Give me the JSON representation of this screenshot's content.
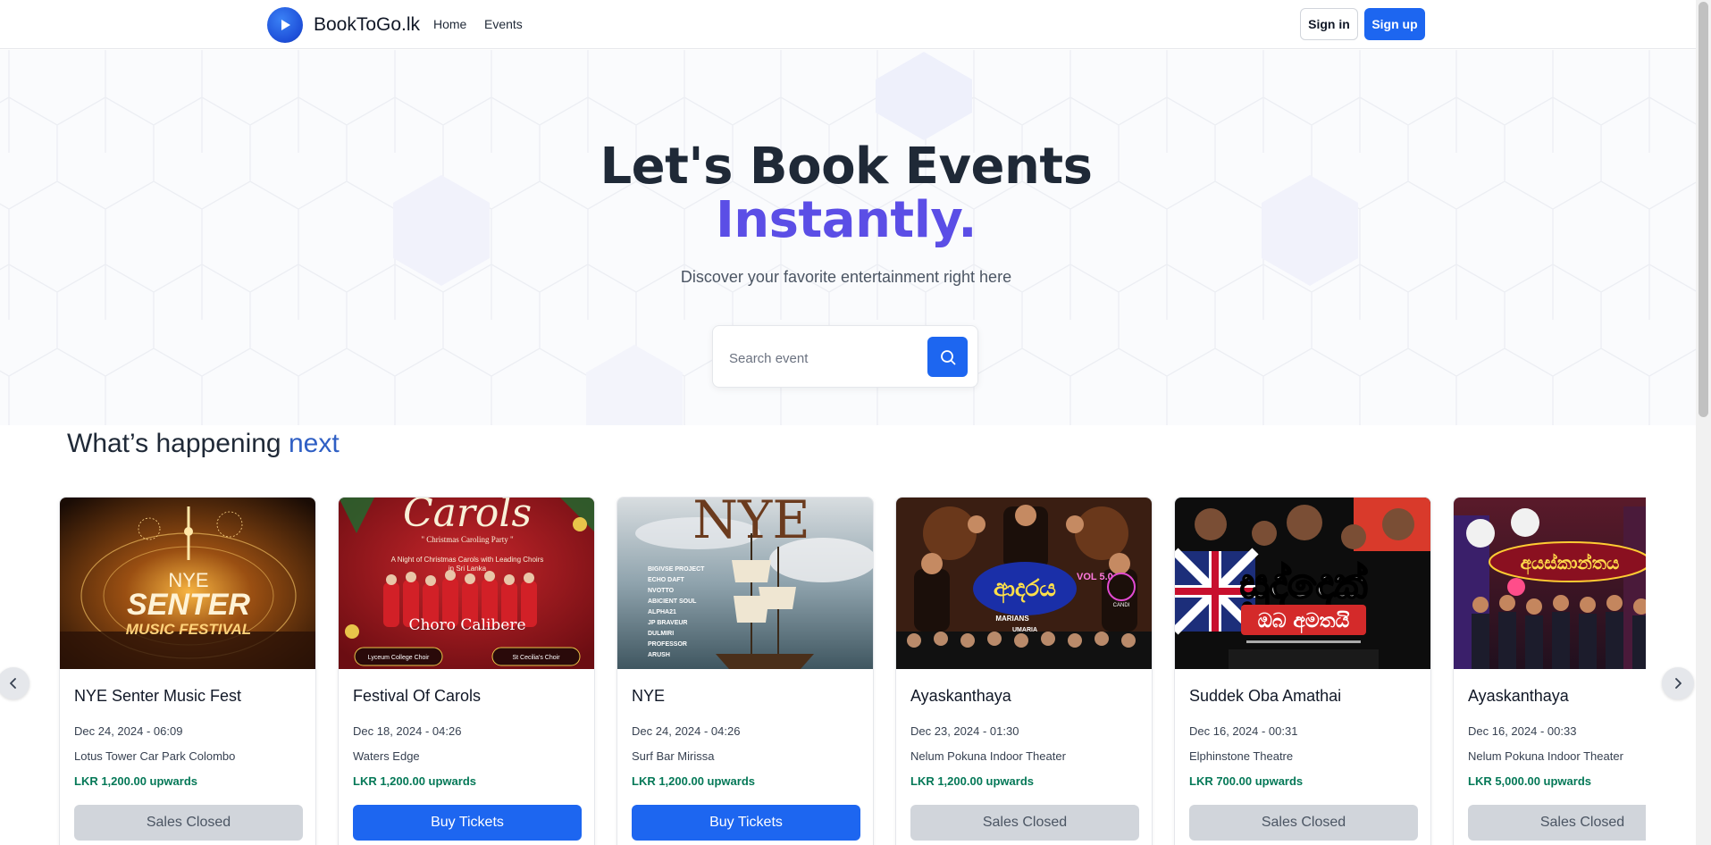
{
  "nav": {
    "brand": "BookToGo.lk",
    "links": [
      "Home",
      "Events"
    ],
    "sign_in": "Sign in",
    "sign_up": "Sign up"
  },
  "hero": {
    "title_line1": "Let's Book Events",
    "title_line2": "Instantly.",
    "subtitle": "Discover your favorite entertainment right here",
    "search_placeholder": "Search event"
  },
  "section": {
    "title_prefix": "What’s happening",
    "title_accent": "next"
  },
  "events": [
    {
      "title": "NYE Senter Music Fest",
      "date": "Dec 24, 2024 - 06:09",
      "venue": "Lotus Tower Car Park Colombo",
      "price": "LKR 1,200.00 upwards",
      "button": "Sales Closed",
      "status": "closed",
      "poster_text": [
        "NYE",
        "SENTER",
        "MUSIC FESTIVAL"
      ]
    },
    {
      "title": "Festival Of Carols",
      "date": "Dec 18, 2024 - 04:26",
      "venue": "Waters Edge",
      "price": "LKR 1,200.00 upwards",
      "button": "Buy Tickets",
      "status": "open",
      "poster_text": [
        "Carols",
        "\" Christmas Caroling Party \"",
        "A Night of Christmas Carols with Leading Choirs",
        "in Sri Lanka",
        "Choro Calibere",
        "Lyceum College Choir",
        "St Cecilia's Choir"
      ]
    },
    {
      "title": "NYE",
      "date": "Dec 24, 2024 - 04:26",
      "venue": "Surf Bar Mirissa",
      "price": "LKR 1,200.00 upwards",
      "button": "Buy Tickets",
      "status": "open",
      "poster_text": [
        "NYE",
        "BIGIVSE PROJECT",
        "ECHO DAFT",
        "NVOTTO",
        "ABICIENT SOUL",
        "ALPHA21",
        "JP BRAVEUR",
        "DULMIRI",
        "PROFESSOR",
        "ARUSH"
      ]
    },
    {
      "title": "Ayaskanthaya",
      "date": "Dec 23, 2024 - 01:30",
      "venue": "Nelum Pokuna Indoor Theater",
      "price": "LKR 1,200.00 upwards",
      "button": "Sales Closed",
      "status": "closed",
      "poster_text": [
        "VOL 5.0",
        "MARIANS",
        "UMARIA",
        "CANDI"
      ]
    },
    {
      "title": "Suddek Oba Amathai",
      "date": "Dec 16, 2024 - 00:31",
      "venue": "Elphinstone Theatre",
      "price": "LKR 700.00 upwards",
      "button": "Sales Closed",
      "status": "closed",
      "poster_text": [
        "සුද්දෙක්",
        "ඔබ අමතයි"
      ]
    },
    {
      "title": "Ayaskanthaya",
      "date": "Dec 16, 2024 - 00:33",
      "venue": "Nelum Pokuna Indoor Theater",
      "price": "LKR 5,000.00 upwards",
      "button": "Sales Closed",
      "status": "closed",
      "poster_text": [
        "අයස්කාන්තය"
      ]
    }
  ],
  "colors": {
    "primary": "#1d66f0",
    "hero_accent": "#5b4ee6",
    "price": "#047857"
  }
}
